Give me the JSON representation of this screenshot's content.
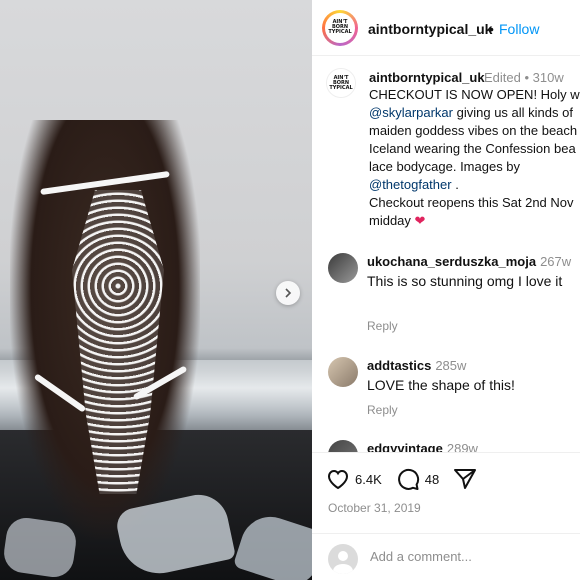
{
  "post": {
    "account": "aintborntypical_uk",
    "follow_label": "Follow",
    "brand_logo_text": [
      "AIN'T",
      "BORN",
      "TYPICAL"
    ],
    "caption": {
      "username": "aintborntypical_uk",
      "edited": "Edited",
      "age": "310w",
      "line1": "CHECKOUT IS NOW OPEN! Holy wo",
      "line2_mention": "@skylarparkar",
      "line2_rest": " giving us all kinds of",
      "line3": "maiden goddess vibes on the beach",
      "line4": "Iceland wearing the Confession bea",
      "line5": "lace bodycage. Images by",
      "line6_mention": "@thetogfather",
      "line6_rest": " .",
      "line7": "Checkout reopens this Sat 2nd Nov",
      "line8": "midday",
      "heart_emoji": "❤"
    },
    "comments": [
      {
        "username": "ukochana_serduszka_moja",
        "age": "267w",
        "text": "This is so stunning omg I love it",
        "reply_label": "Reply"
      },
      {
        "username": "addtastics",
        "age": "285w",
        "text": "LOVE the shape of this!",
        "reply_label": "Reply"
      },
      {
        "username": "edgyvintage",
        "age": "289w"
      }
    ],
    "likes": "6.4K",
    "comment_count": "48",
    "date": "October 31, 2019",
    "add_comment_placeholder": "Add a comment..."
  },
  "colors": {
    "link_blue": "#0095f6",
    "mention_blue": "#00376b",
    "muted": "#8e8e8e",
    "heart_red": "#e0245e"
  },
  "icons": [
    "next-arrow-icon",
    "heart-icon",
    "comment-bubble-icon",
    "share-plane-icon",
    "user-placeholder-icon"
  ]
}
